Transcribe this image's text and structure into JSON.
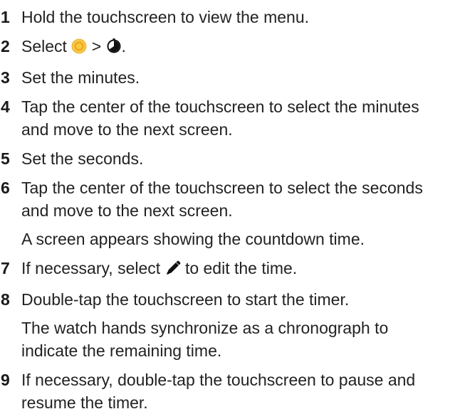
{
  "steps": [
    {
      "number": "1",
      "text": "Hold the touchscreen to view the menu."
    },
    {
      "number": "2",
      "text_before": "Select",
      "separator": ">",
      "text_after": ".",
      "icons": [
        "clock-app-icon",
        "timer-icon"
      ]
    },
    {
      "number": "3",
      "text": "Set the minutes."
    },
    {
      "number": "4",
      "text": "Tap the center of the touchscreen to select the minutes and move to the next screen."
    },
    {
      "number": "5",
      "text": "Set the seconds."
    },
    {
      "number": "6",
      "text": "Tap the center of the touchscreen to select the seconds and move to the next screen.",
      "note": "A screen appears showing the countdown time."
    },
    {
      "number": "7",
      "text_before": "If necessary, select",
      "text_after": "to edit the time.",
      "icons": [
        "pencil-icon"
      ]
    },
    {
      "number": "8",
      "text": "Double-tap the touchscreen to start the timer.",
      "note": "The watch hands synchronize as a chronograph to indicate the remaining time."
    },
    {
      "number": "9",
      "text": "If necessary, double-tap the touchscreen to pause and resume the timer."
    }
  ],
  "colors": {
    "text": "#222222",
    "clock_icon_outer": "#f5c84a",
    "clock_icon_inner": "#f2a81e"
  }
}
